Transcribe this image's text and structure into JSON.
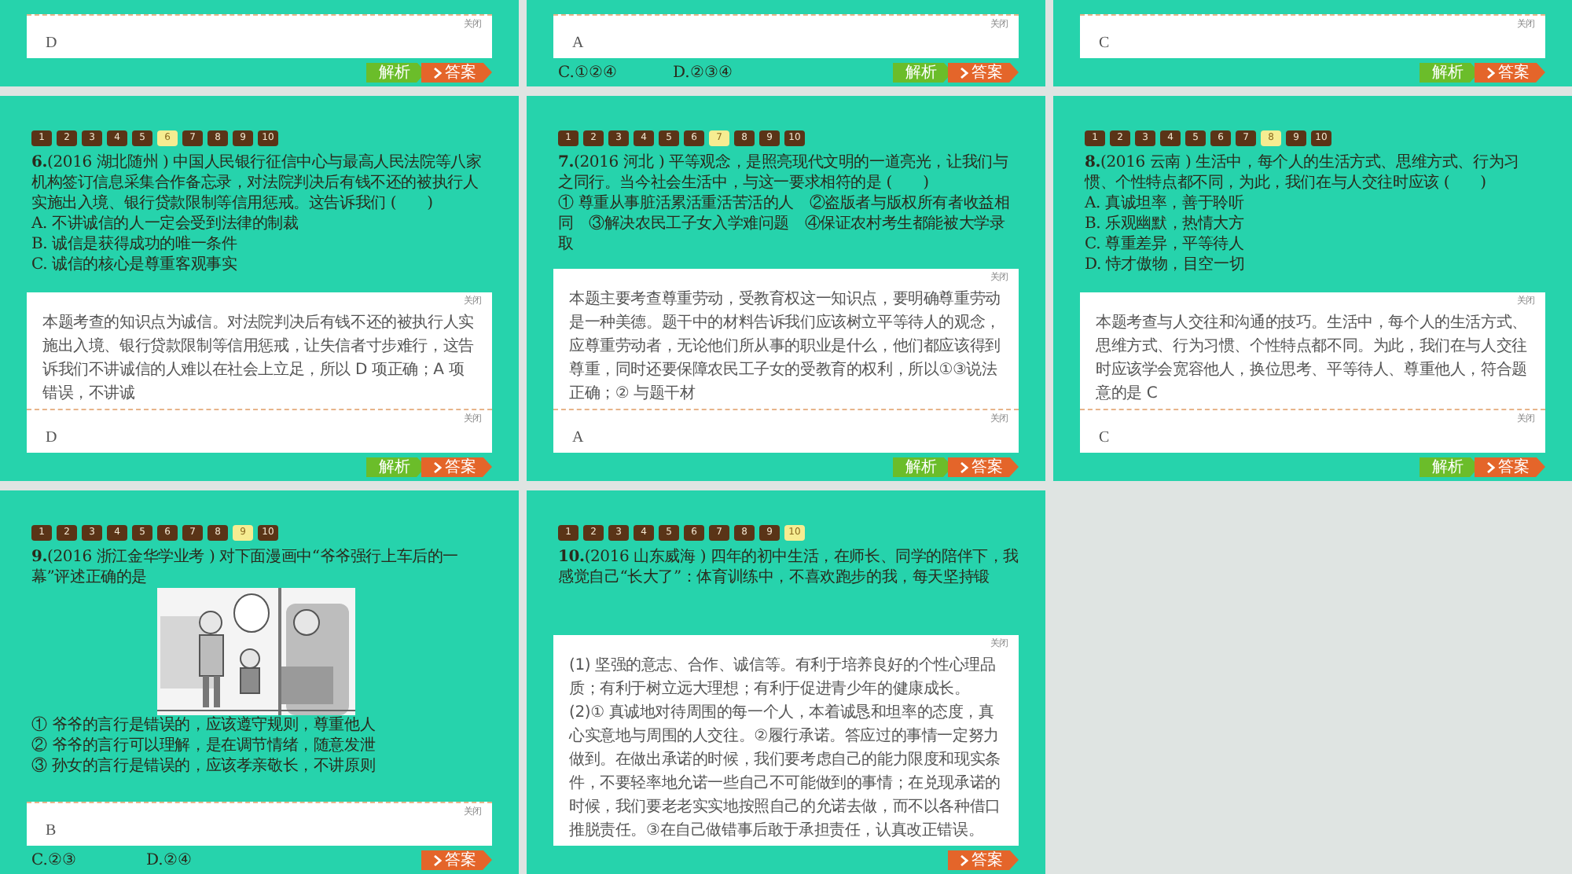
{
  "slides": [
    {
      "kind": "tail",
      "answer": {
        "close": "关闭",
        "text": "D"
      },
      "buttons": [
        {
          "kind": "analysis",
          "label": "解析"
        },
        {
          "kind": "answer",
          "label": "答案"
        }
      ]
    },
    {
      "kind": "tail",
      "answer": {
        "close": "关闭",
        "text": "A"
      },
      "options": [
        "C.①②④",
        "D.②③④"
      ],
      "buttons": [
        {
          "kind": "analysis",
          "label": "解析"
        },
        {
          "kind": "answer",
          "label": "答案"
        }
      ]
    },
    {
      "kind": "tail",
      "answer": {
        "close": "关闭",
        "text": "C"
      },
      "buttons": [
        {
          "kind": "analysis",
          "label": "解析"
        },
        {
          "kind": "answer",
          "label": "答案"
        }
      ]
    },
    {
      "kind": "question",
      "nav": [
        {
          "label": "1",
          "selected": false
        },
        {
          "label": "2",
          "selected": false
        },
        {
          "label": "3",
          "selected": false
        },
        {
          "label": "4",
          "selected": false
        },
        {
          "label": "5",
          "selected": false
        },
        {
          "label": "6",
          "selected": true
        },
        {
          "label": "7",
          "selected": false
        },
        {
          "label": "8",
          "selected": false
        },
        {
          "label": "9",
          "selected": false
        },
        {
          "label": "10",
          "selected": false
        }
      ],
      "question": "**6.**(2016 湖北随州 ) 中国人民银行征信中心与最高人民法院等八家机构签订信息采集合作备忘录，对法院判决后有钱不还的被执行人实施出入境、银行贷款限制等信用惩戒。这告诉我们 (　　)",
      "choices": [
        "A. 不讲诚信的人一定会受到法律的制裁",
        "B. 诚信是获得成功的唯一条件",
        "C. 诚信的核心是尊重客观事实"
      ],
      "explanation": {
        "close": "关闭",
        "paragraphs": [
          "本题考查的知识点为诚信。对法院判决后有钱不还的被执行人实施出入境、银行贷款限制等信用惩戒，让失信者寸步难行，这告诉我们不讲诚信的人难以在社会上立足，所以 D 项正确；A 项错误，不讲诚"
        ]
      },
      "answer": {
        "close": "关闭",
        "text": "D"
      },
      "buttons": [
        {
          "kind": "analysis",
          "label": "解析"
        },
        {
          "kind": "answer",
          "label": "答案"
        }
      ]
    },
    {
      "kind": "question",
      "nav": [
        {
          "label": "1",
          "selected": false
        },
        {
          "label": "2",
          "selected": false
        },
        {
          "label": "3",
          "selected": false
        },
        {
          "label": "4",
          "selected": false
        },
        {
          "label": "5",
          "selected": false
        },
        {
          "label": "6",
          "selected": false
        },
        {
          "label": "7",
          "selected": true
        },
        {
          "label": "8",
          "selected": false
        },
        {
          "label": "9",
          "selected": false
        },
        {
          "label": "10",
          "selected": false
        }
      ],
      "question": "**7.**(2016 河北 ) 平等观念，是照亮现代文明的一道亮光，让我们与之同行。当今社会生活中，与这一要求相符的是 (　　)",
      "choices": [
        "① 尊重从事脏活累活重活苦活的人　②盗版者与版权所有者收益相同　③解决农民工子女入学难问题　④保证农村考生都能被大学录取"
      ],
      "explanation": {
        "close": "关闭",
        "paragraphs": [
          "本题主要考查尊重劳动，受教育权这一知识点，要明确尊重劳动是一种美德。题干中的材料告诉我们应该树立平等待人的观念，应尊重劳动者，无论他们所从事的职业是什么，他们都应该得到尊重，同时还要保障农民工子女的受教育的权利，所以①③说法正确；② 与题干材"
        ]
      },
      "answer": {
        "close": "关闭",
        "text": "A"
      },
      "buttons": [
        {
          "kind": "analysis",
          "label": "解析"
        },
        {
          "kind": "answer",
          "label": "答案"
        }
      ]
    },
    {
      "kind": "question",
      "nav": [
        {
          "label": "1",
          "selected": false
        },
        {
          "label": "2",
          "selected": false
        },
        {
          "label": "3",
          "selected": false
        },
        {
          "label": "4",
          "selected": false
        },
        {
          "label": "5",
          "selected": false
        },
        {
          "label": "6",
          "selected": false
        },
        {
          "label": "7",
          "selected": false
        },
        {
          "label": "8",
          "selected": true
        },
        {
          "label": "9",
          "selected": false
        },
        {
          "label": "10",
          "selected": false
        }
      ],
      "question": "**8.**(2016 云南 ) 生活中，每个人的生活方式、思维方式、行为习惯、个性特点都不同，为此，我们在与人交往时应该 (　　)",
      "choices": [
        "A. 真诚坦率，善于聆听",
        "B. 乐观幽默，热情大方",
        "C. 尊重差异，平等待人",
        "D. 恃才傲物，目空一切"
      ],
      "explanation": {
        "close": "关闭",
        "paragraphs": [
          "本题考查与人交往和沟通的技巧。生活中，每个人的生活方式、思维方式、行为习惯、个性特点都不同。为此，我们在与人交往时应该学会宽容他人，换位思考、平等待人、尊重他人，符合题意的是 C"
        ]
      },
      "answer": {
        "close": "关闭",
        "text": "C"
      },
      "buttons": [
        {
          "kind": "analysis",
          "label": "解析"
        },
        {
          "kind": "answer",
          "label": "答案"
        }
      ]
    },
    {
      "kind": "question",
      "nav": [
        {
          "label": "1",
          "selected": false
        },
        {
          "label": "2",
          "selected": false
        },
        {
          "label": "3",
          "selected": false
        },
        {
          "label": "4",
          "selected": false
        },
        {
          "label": "5",
          "selected": false
        },
        {
          "label": "6",
          "selected": false
        },
        {
          "label": "7",
          "selected": false
        },
        {
          "label": "8",
          "selected": false
        },
        {
          "label": "9",
          "selected": true
        },
        {
          "label": "10",
          "selected": false
        }
      ],
      "question": "**9.**(2016 浙江金华学业考 ) 对下面漫画中“爷爷强行上车后的一幕”评述正确的是",
      "picture": {
        "kind": "picture"
      },
      "choices": [
        "① 爷爷的言行是错误的，应该遵守规则，尊重他人",
        "② 爷爷的言行可以理解，是在调节情绪，随意发泄",
        "③ 孙女的言行是错误的，应该孝亲敬长，不讲原则"
      ],
      "answer": {
        "close": "关闭",
        "text": "B"
      },
      "options": [
        "C.②③",
        "D.②④"
      ],
      "buttons": [
        {
          "kind": "answer",
          "label": "答案"
        }
      ]
    },
    {
      "kind": "question",
      "nav": [
        {
          "label": "1",
          "selected": false
        },
        {
          "label": "2",
          "selected": false
        },
        {
          "label": "3",
          "selected": false
        },
        {
          "label": "4",
          "selected": false
        },
        {
          "label": "5",
          "selected": false
        },
        {
          "label": "6",
          "selected": false
        },
        {
          "label": "7",
          "selected": false
        },
        {
          "label": "8",
          "selected": false
        },
        {
          "label": "9",
          "selected": false
        },
        {
          "label": "10",
          "selected": true
        }
      ],
      "question": "**10.**(2016 山东威海 ) 四年的初中生活，在师长、同学的陪伴下，我感觉自己“长大了”：体育训练中，不喜欢跑步的我，每天坚持锻",
      "explanation": {
        "close": "关闭",
        "paragraphs": [
          "(1) 坚强的意志、合作、诚信等。有利于培养良好的个性心理品质；有利于树立远大理想；有利于促进青少年的健康成长。",
          "(2)① 真诚地对待周围的每一个人，本着诚恳和坦率的态度，真心实意地与周围的人交往。②履行承诺。答应过的事情一定努力做到。在做出承诺的时候，我们要考虑自己的能力限度和现实条件，不要轻率地允诺一些自己不可能做到的事情；在兑现承诺的时候，我们要老老实实地按照自己的允诺去做，而不以各种借口推脱责任。③在自己做错事后敢于承担责任，认真改正错误。"
        ]
      },
      "buttons": [
        {
          "kind": "answer",
          "label": "答案"
        }
      ]
    }
  ]
}
